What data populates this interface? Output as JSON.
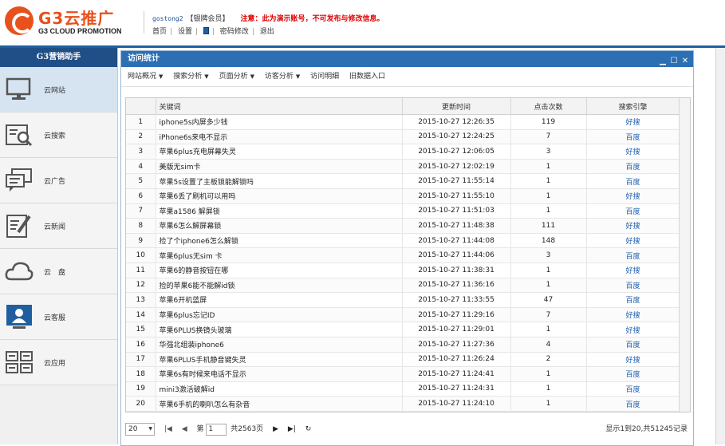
{
  "brand": {
    "logo_text": "G3云推广",
    "logo_sub": "G3 CLOUD PROMOTION"
  },
  "header": {
    "username": "gostong2",
    "member_level": "【银牌会员】",
    "notice": "注意：此为演示账号，不可发布与修改信息。",
    "nav": [
      "首页",
      "设置",
      "密码修改",
      "退出"
    ]
  },
  "sidebar": {
    "title": "G3营销助手",
    "items": [
      {
        "label": "云网站",
        "icon": "monitor-icon"
      },
      {
        "label": "云搜索",
        "icon": "search-doc-icon"
      },
      {
        "label": "云广告",
        "icon": "chat-icon"
      },
      {
        "label": "云新闻",
        "icon": "edit-doc-icon"
      },
      {
        "label": "云　盘",
        "icon": "cloud-icon"
      },
      {
        "label": "云客服",
        "icon": "user-service-icon"
      },
      {
        "label": "云应用",
        "icon": "apps-icon"
      }
    ]
  },
  "panel": {
    "title": "访问统计",
    "toolbar": [
      {
        "label": "网站概况",
        "dropdown": true
      },
      {
        "label": "搜索分析",
        "dropdown": true
      },
      {
        "label": "页面分析",
        "dropdown": true
      },
      {
        "label": "访客分析",
        "dropdown": true
      },
      {
        "label": "访问明细",
        "dropdown": false
      },
      {
        "label": "旧数据入口",
        "dropdown": false
      }
    ],
    "table": {
      "headers": [
        "",
        "关键词",
        "更新时间",
        "点击次数",
        "搜索引擎"
      ],
      "rows": [
        [
          "1",
          "iphone5s内屏多少钱",
          "2015-10-27 12:26:35",
          "119",
          "好搜"
        ],
        [
          "2",
          "iPhone6s来电不显示",
          "2015-10-27 12:24:25",
          "7",
          "百度"
        ],
        [
          "3",
          "苹果6plus充电屏幕失灵",
          "2015-10-27 12:06:05",
          "3",
          "好搜"
        ],
        [
          "4",
          "美版无sim卡",
          "2015-10-27 12:02:19",
          "1",
          "百度"
        ],
        [
          "5",
          "苹果5s设置了主板锁能解锁吗",
          "2015-10-27 11:55:14",
          "1",
          "百度"
        ],
        [
          "6",
          "苹果6丢了刷机可以用吗",
          "2015-10-27 11:55:10",
          "1",
          "好搜"
        ],
        [
          "7",
          "苹果a1586 解屏锁",
          "2015-10-27 11:51:03",
          "1",
          "百度"
        ],
        [
          "8",
          "苹果6怎么解屏幕锁",
          "2015-10-27 11:48:38",
          "111",
          "好搜"
        ],
        [
          "9",
          "捡了个iphone6怎么解锁",
          "2015-10-27 11:44:08",
          "148",
          "好搜"
        ],
        [
          "10",
          "苹果6plus无sim 卡",
          "2015-10-27 11:44:06",
          "3",
          "百度"
        ],
        [
          "11",
          "苹果6的静音按钮在哪",
          "2015-10-27 11:38:31",
          "1",
          "好搜"
        ],
        [
          "12",
          "捡的苹果6能不能解id锁",
          "2015-10-27 11:36:16",
          "1",
          "百度"
        ],
        [
          "13",
          "苹果6开机蓝屏",
          "2015-10-27 11:33:55",
          "47",
          "百度"
        ],
        [
          "14",
          "苹果6plus忘记ID",
          "2015-10-27 11:29:16",
          "7",
          "好搜"
        ],
        [
          "15",
          "苹果6PLUS换镜头玻璃",
          "2015-10-27 11:29:01",
          "1",
          "好搜"
        ],
        [
          "16",
          "华强北组装iphone6",
          "2015-10-27 11:27:36",
          "4",
          "百度"
        ],
        [
          "17",
          "苹果6PLUS手机静音键失灵",
          "2015-10-27 11:26:24",
          "2",
          "好搜"
        ],
        [
          "18",
          "苹果6s有时候来电话不显示",
          "2015-10-27 11:24:41",
          "1",
          "百度"
        ],
        [
          "19",
          "mini3激活破解id",
          "2015-10-27 11:24:31",
          "1",
          "百度"
        ],
        [
          "20",
          "苹果6手机的喇叭怎么有杂音",
          "2015-10-27 11:24:10",
          "1",
          "百度"
        ]
      ]
    },
    "pager": {
      "page_size": "20",
      "page_prefix": "第",
      "page_value": "1",
      "page_total": "共2563页",
      "info": "显示1到20,共51245记录"
    }
  },
  "colors": {
    "accent": "#2d6fb3",
    "brand": "#e8501c",
    "notice": "#e00000",
    "link": "#1c5fb0"
  }
}
